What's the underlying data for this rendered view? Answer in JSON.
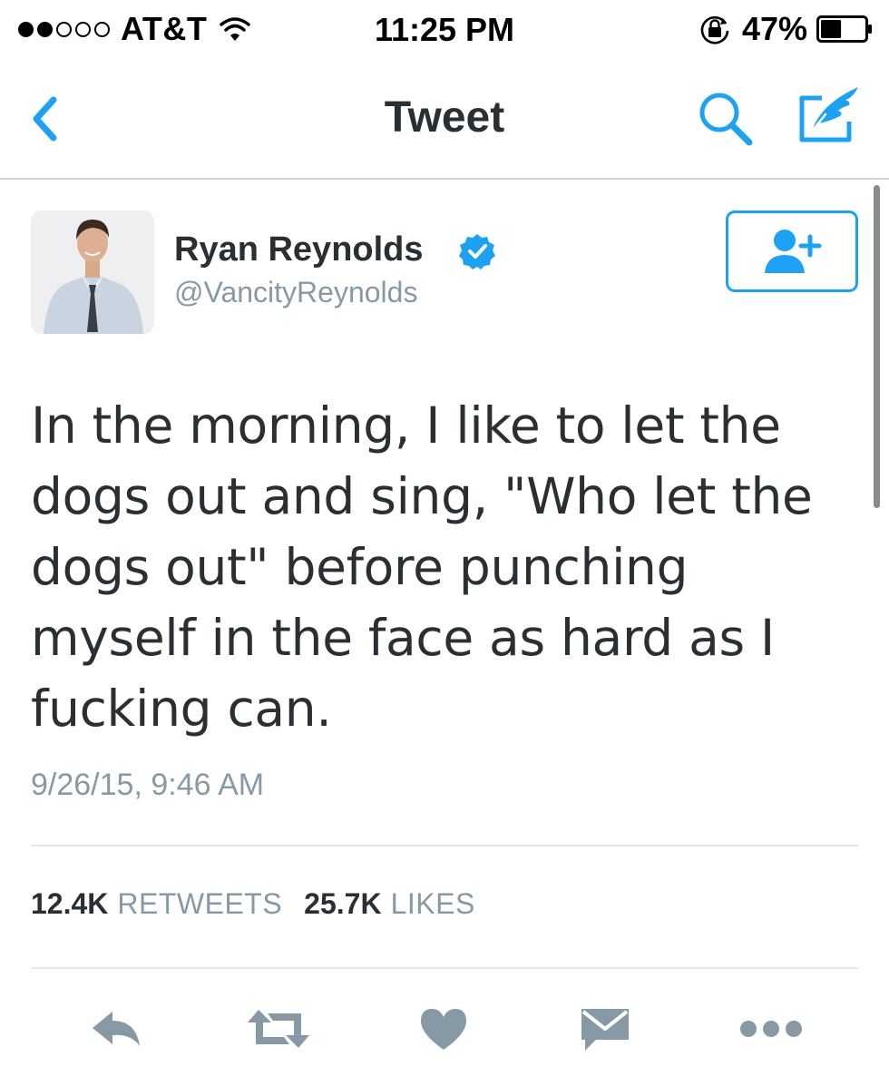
{
  "status_bar": {
    "signal_filled": 2,
    "signal_total": 5,
    "carrier": "AT&T",
    "time": "11:25 PM",
    "battery_percent": "47%",
    "battery_level": 0.47
  },
  "nav": {
    "title": "Tweet",
    "icons": [
      "back-chevron-icon",
      "search-icon",
      "compose-icon"
    ]
  },
  "tweet": {
    "author_name": "Ryan Reynolds",
    "author_handle": "@VancityReynolds",
    "verified": true,
    "text": "In the morning, I like to let the dogs out and sing, \"Who let the dogs out\" before punching myself in the face as hard as I fucking can.",
    "timestamp": "9/26/15, 9:46 AM",
    "retweets_count": "12.4K",
    "retweets_label": "RETWEETS",
    "likes_count": "25.7K",
    "likes_label": "LIKES"
  },
  "actions": [
    "reply-icon",
    "retweet-icon",
    "like-heart-icon",
    "direct-message-icon",
    "more-icon"
  ],
  "colors": {
    "accent": "#1da1f2",
    "text_primary": "#292f33",
    "text_secondary": "#8899a6",
    "action_icon": "#8899a6",
    "divider": "#e1e8ed"
  }
}
